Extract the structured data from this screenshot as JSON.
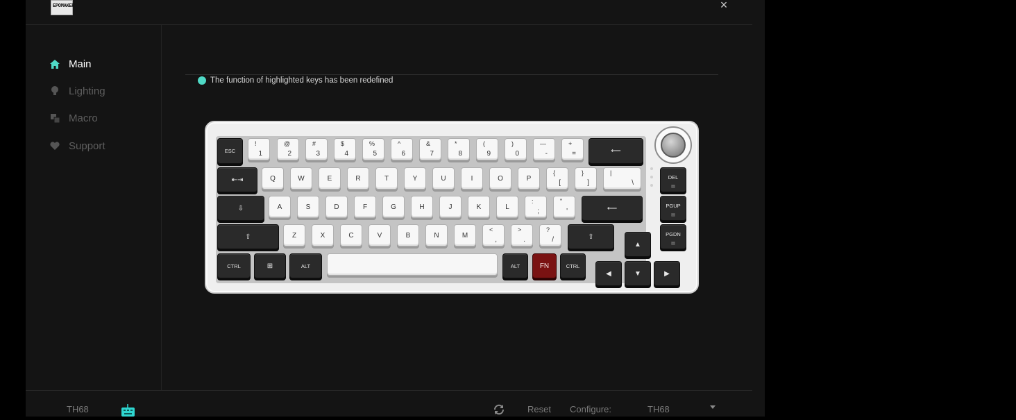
{
  "app": {
    "logo_text": "EPOMAKER",
    "close_symbol": "×"
  },
  "sidebar": {
    "items": [
      {
        "label": "Main",
        "icon": "home-icon",
        "active": true
      },
      {
        "label": "Lighting",
        "icon": "bulb-icon",
        "active": false
      },
      {
        "label": "Macro",
        "icon": "macro-icon",
        "active": false
      },
      {
        "label": "Support",
        "icon": "heart-icon",
        "active": false
      }
    ]
  },
  "notice": {
    "text": "The function of highlighted keys has been redefined",
    "color": "#4fd9c6"
  },
  "footer": {
    "device_name": "TH68",
    "reset_label": "Reset",
    "configure_label": "Configure:",
    "configure_value": "TH68"
  },
  "keyboard": {
    "rows": [
      [
        {
          "id": "esc",
          "label": "ESC",
          "style": "d"
        },
        {
          "id": "1",
          "top": "!",
          "bot": "1",
          "style": "w"
        },
        {
          "id": "2",
          "top": "@",
          "bot": "2",
          "style": "w"
        },
        {
          "id": "3",
          "top": "#",
          "bot": "3",
          "style": "w"
        },
        {
          "id": "4",
          "top": "$",
          "bot": "4",
          "style": "w"
        },
        {
          "id": "5",
          "top": "%",
          "bot": "5",
          "style": "w"
        },
        {
          "id": "6",
          "top": "^",
          "bot": "6",
          "style": "w"
        },
        {
          "id": "7",
          "top": "&",
          "bot": "7",
          "style": "w"
        },
        {
          "id": "8",
          "top": "*",
          "bot": "8",
          "style": "w"
        },
        {
          "id": "9",
          "top": "(",
          "bot": "9",
          "style": "w"
        },
        {
          "id": "0",
          "top": ")",
          "bot": "0",
          "style": "w"
        },
        {
          "id": "minus",
          "top": "—",
          "bot": "-",
          "style": "w"
        },
        {
          "id": "equal",
          "top": "+",
          "bot": "=",
          "style": "w"
        },
        {
          "id": "backspace",
          "label": "⟵",
          "style": "d"
        }
      ],
      [
        {
          "id": "tab",
          "label": "⇤⇥",
          "style": "d"
        },
        {
          "id": "q",
          "label": "Q",
          "style": "w"
        },
        {
          "id": "w",
          "label": "W",
          "style": "w"
        },
        {
          "id": "e",
          "label": "E",
          "style": "w"
        },
        {
          "id": "r",
          "label": "R",
          "style": "w"
        },
        {
          "id": "t",
          "label": "T",
          "style": "w"
        },
        {
          "id": "y",
          "label": "Y",
          "style": "w"
        },
        {
          "id": "u",
          "label": "U",
          "style": "w"
        },
        {
          "id": "i",
          "label": "I",
          "style": "w"
        },
        {
          "id": "o",
          "label": "O",
          "style": "w"
        },
        {
          "id": "p",
          "label": "P",
          "style": "w"
        },
        {
          "id": "lbracket",
          "top": "{",
          "bot": "[",
          "style": "w"
        },
        {
          "id": "rbracket",
          "top": "}",
          "bot": "]",
          "style": "w"
        },
        {
          "id": "backslash",
          "top": "|",
          "bot": "\\",
          "style": "w"
        },
        {
          "id": "del",
          "label": "DEL",
          "style": "d"
        }
      ],
      [
        {
          "id": "caps",
          "label": "⇩",
          "style": "d"
        },
        {
          "id": "a",
          "label": "A",
          "style": "w"
        },
        {
          "id": "s",
          "label": "S",
          "style": "w"
        },
        {
          "id": "d",
          "label": "D",
          "style": "w"
        },
        {
          "id": "f",
          "label": "F",
          "style": "w"
        },
        {
          "id": "g",
          "label": "G",
          "style": "w"
        },
        {
          "id": "h",
          "label": "H",
          "style": "w"
        },
        {
          "id": "j",
          "label": "J",
          "style": "w"
        },
        {
          "id": "k",
          "label": "K",
          "style": "w"
        },
        {
          "id": "l",
          "label": "L",
          "style": "w"
        },
        {
          "id": "semicolon",
          "top": ":",
          "bot": ";",
          "style": "w"
        },
        {
          "id": "quote",
          "top": "\"",
          "bot": "'",
          "style": "w"
        },
        {
          "id": "enter",
          "label": "⟵",
          "style": "d"
        },
        {
          "id": "pgup",
          "label": "PGUP",
          "style": "d"
        }
      ],
      [
        {
          "id": "lshift",
          "label": "⇧",
          "style": "d"
        },
        {
          "id": "z",
          "label": "Z",
          "style": "w"
        },
        {
          "id": "x",
          "label": "X",
          "style": "w"
        },
        {
          "id": "c",
          "label": "C",
          "style": "w"
        },
        {
          "id": "v",
          "label": "V",
          "style": "w"
        },
        {
          "id": "b",
          "label": "B",
          "style": "w"
        },
        {
          "id": "n",
          "label": "N",
          "style": "w"
        },
        {
          "id": "m",
          "label": "M",
          "style": "w"
        },
        {
          "id": "comma",
          "top": "<",
          "bot": ",",
          "style": "w"
        },
        {
          "id": "period",
          "top": ">",
          "bot": ".",
          "style": "w"
        },
        {
          "id": "slash",
          "top": "?",
          "bot": "/",
          "style": "w"
        },
        {
          "id": "rshift",
          "label": "⇧",
          "style": "d"
        },
        {
          "id": "up",
          "label": "▲",
          "style": "d"
        },
        {
          "id": "pgdn",
          "label": "PGDN",
          "style": "d"
        }
      ],
      [
        {
          "id": "lctrl",
          "label": "CTRL",
          "style": "d"
        },
        {
          "id": "win",
          "label": "⊞",
          "style": "d"
        },
        {
          "id": "lalt",
          "label": "ALT",
          "style": "d"
        },
        {
          "id": "space",
          "label": "",
          "style": "w"
        },
        {
          "id": "ralt",
          "label": "ALT",
          "style": "d"
        },
        {
          "id": "fn",
          "label": "FN",
          "style": "r"
        },
        {
          "id": "rctrl",
          "label": "CTRL",
          "style": "d"
        },
        {
          "id": "left",
          "label": "◀",
          "style": "d"
        },
        {
          "id": "down",
          "label": "▼",
          "style": "d"
        },
        {
          "id": "right",
          "label": "▶",
          "style": "d"
        }
      ]
    ]
  }
}
